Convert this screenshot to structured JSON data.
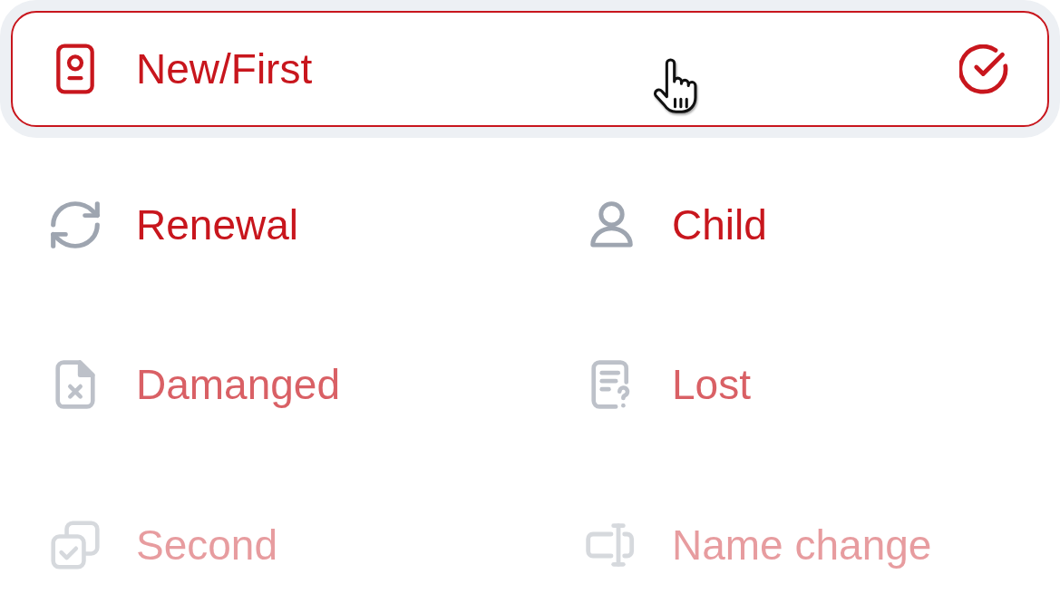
{
  "options": [
    {
      "label": "New/First",
      "selected": true
    },
    {
      "label": "Renewal",
      "selected": false
    },
    {
      "label": "Child",
      "selected": false
    },
    {
      "label": "Damanged",
      "selected": false
    },
    {
      "label": "Lost",
      "selected": false
    },
    {
      "label": "Second",
      "selected": false
    },
    {
      "label": "Name change",
      "selected": false
    }
  ]
}
